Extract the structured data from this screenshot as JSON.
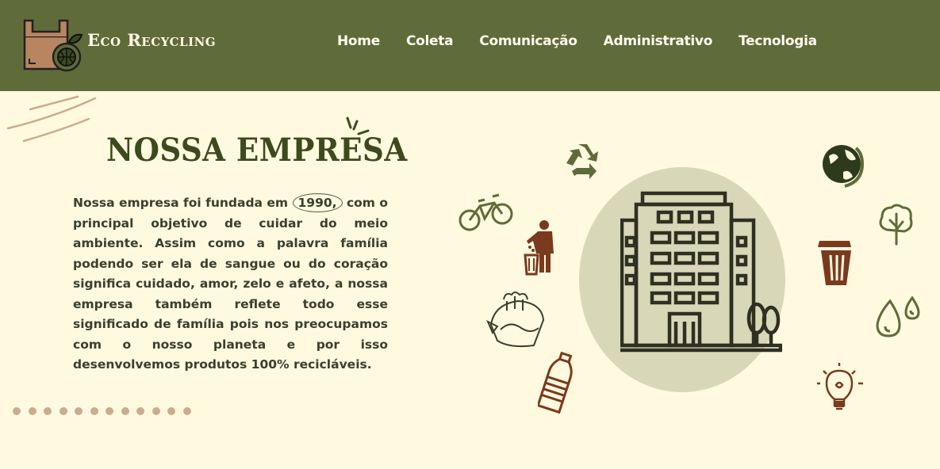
{
  "header": {
    "brand": "Eco Recycling",
    "nav": [
      {
        "label": "Home"
      },
      {
        "label": "Coleta"
      },
      {
        "label": "Comunicação"
      },
      {
        "label": "Administrativo"
      },
      {
        "label": "Tecnologia"
      }
    ]
  },
  "main": {
    "title": "NOSSA EMPRESA",
    "paragraph_before": "Nossa empresa foi fundada em ",
    "year": "1990,",
    "paragraph_after": " com o principal objetivo de cuidar do meio ambiente. Assim como a palavra família podendo ser ela de sangue ou do coração significa cuidado, amor, zelo e afeto, a nossa empresa também reflete todo esse significado de família pois nos preocupamos com o nosso planeta e por isso desenvolvemos produtos 100% recicláveis."
  },
  "icons": [
    "recycle-icon",
    "globe-icon",
    "bicycle-icon",
    "tree-icon",
    "person-trash-icon",
    "trash-bin-icon",
    "earth-city-icon",
    "water-drops-icon",
    "plastic-bottle-icon",
    "lightbulb-icon",
    "building-icon"
  ],
  "colors": {
    "header": "#5f6b39",
    "background": "#fef9df",
    "heading": "#3d4a1e",
    "accent_brown": "#7a3a1e",
    "circle": "#d8d8b8"
  }
}
